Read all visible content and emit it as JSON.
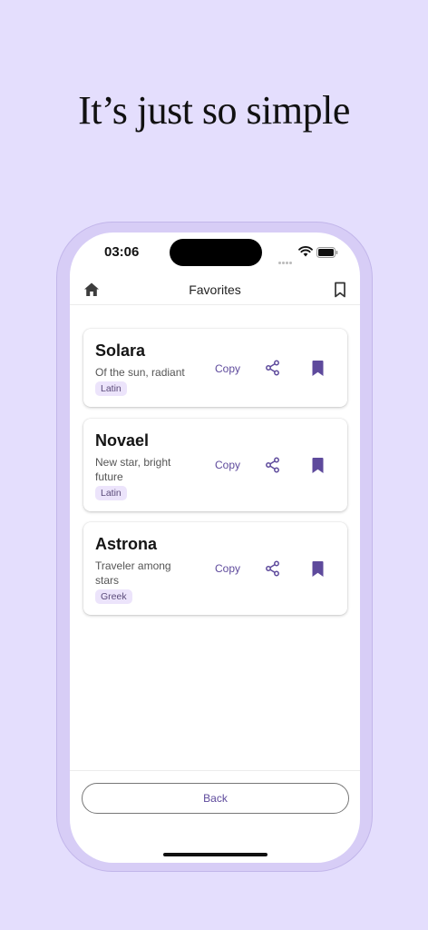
{
  "headline": "It’s just so simple",
  "status_bar": {
    "time": "03:06"
  },
  "appbar": {
    "title": "Favorites",
    "home_icon": "home-icon",
    "bookmarks_icon": "bookmark-outline-icon"
  },
  "favorites": [
    {
      "name": "Solara",
      "meaning": "Of the sun, radiant",
      "origin": "Latin",
      "copy_label": "Copy"
    },
    {
      "name": "Novael",
      "meaning": "New star, bright future",
      "origin": "Latin",
      "copy_label": "Copy"
    },
    {
      "name": "Astrona",
      "meaning": "Traveler among stars",
      "origin": "Greek",
      "copy_label": "Copy"
    }
  ],
  "back_label": "Back",
  "colors": {
    "background": "#e4defd",
    "accent": "#5e4a9c",
    "tag_background": "#ece4fb"
  }
}
